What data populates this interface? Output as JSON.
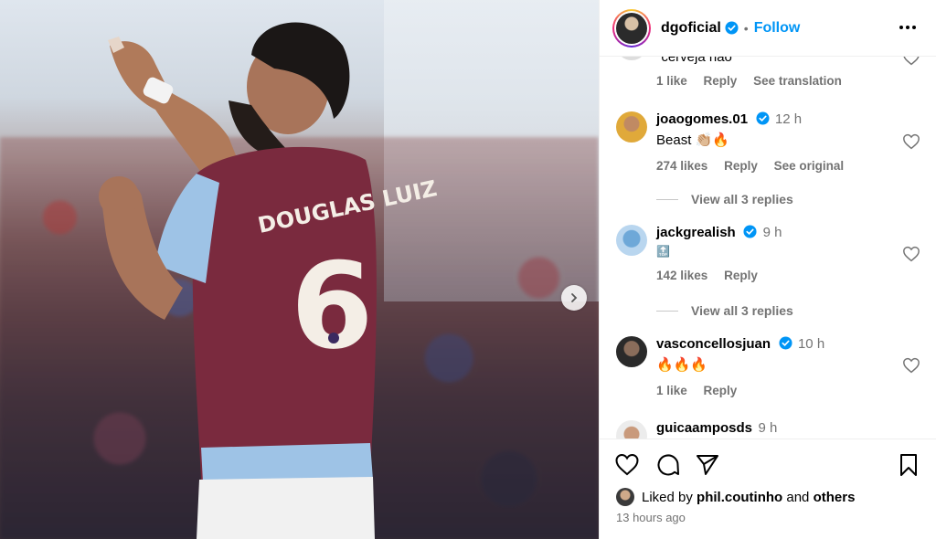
{
  "post": {
    "jersey_name": "DOUGLAS LUIZ",
    "jersey_number": "6"
  },
  "header": {
    "username": "dgoficial",
    "separator": "•",
    "follow_label": "Follow"
  },
  "comments": [
    {
      "username": "",
      "time": "",
      "text": "\"cerveja não\"",
      "likes": "1 like",
      "reply_label": "Reply",
      "extra_label": "See translation",
      "view_replies": ""
    },
    {
      "username": "joaogomes.01",
      "time": "12 h",
      "text": "Beast 👏🏼🔥",
      "likes": "274 likes",
      "reply_label": "Reply",
      "extra_label": "See original",
      "view_replies": "View all 3 replies"
    },
    {
      "username": "jackgrealish",
      "time": "9 h",
      "text": "🔝",
      "likes": "142 likes",
      "reply_label": "Reply",
      "extra_label": "",
      "view_replies": "View all 3 replies"
    },
    {
      "username": "vasconcellosjuan",
      "time": "10 h",
      "text": "🔥🔥🔥",
      "likes": "1 like",
      "reply_label": "Reply",
      "extra_label": "",
      "view_replies": ""
    },
    {
      "username": "guicaamposds",
      "time": "9 h",
      "text": "",
      "likes": "",
      "reply_label": "",
      "extra_label": "",
      "view_replies": ""
    }
  ],
  "footer": {
    "liked_by_prefix": "Liked by",
    "liked_by_user": "phil.coutinho",
    "liked_by_and": "and",
    "liked_by_others": "others",
    "time_ago": "13 hours ago"
  },
  "colors": {
    "accent": "#0095f6",
    "verified": "#0095f6",
    "muted": "#737373",
    "jersey_claret": "#7a2a3e",
    "jersey_blue": "#9ec3e6"
  },
  "icons": {
    "next": "chevron-right-icon",
    "more": "more-horizontal-icon",
    "like": "heart-icon",
    "comment": "comment-icon",
    "share": "send-icon",
    "save": "bookmark-icon"
  }
}
